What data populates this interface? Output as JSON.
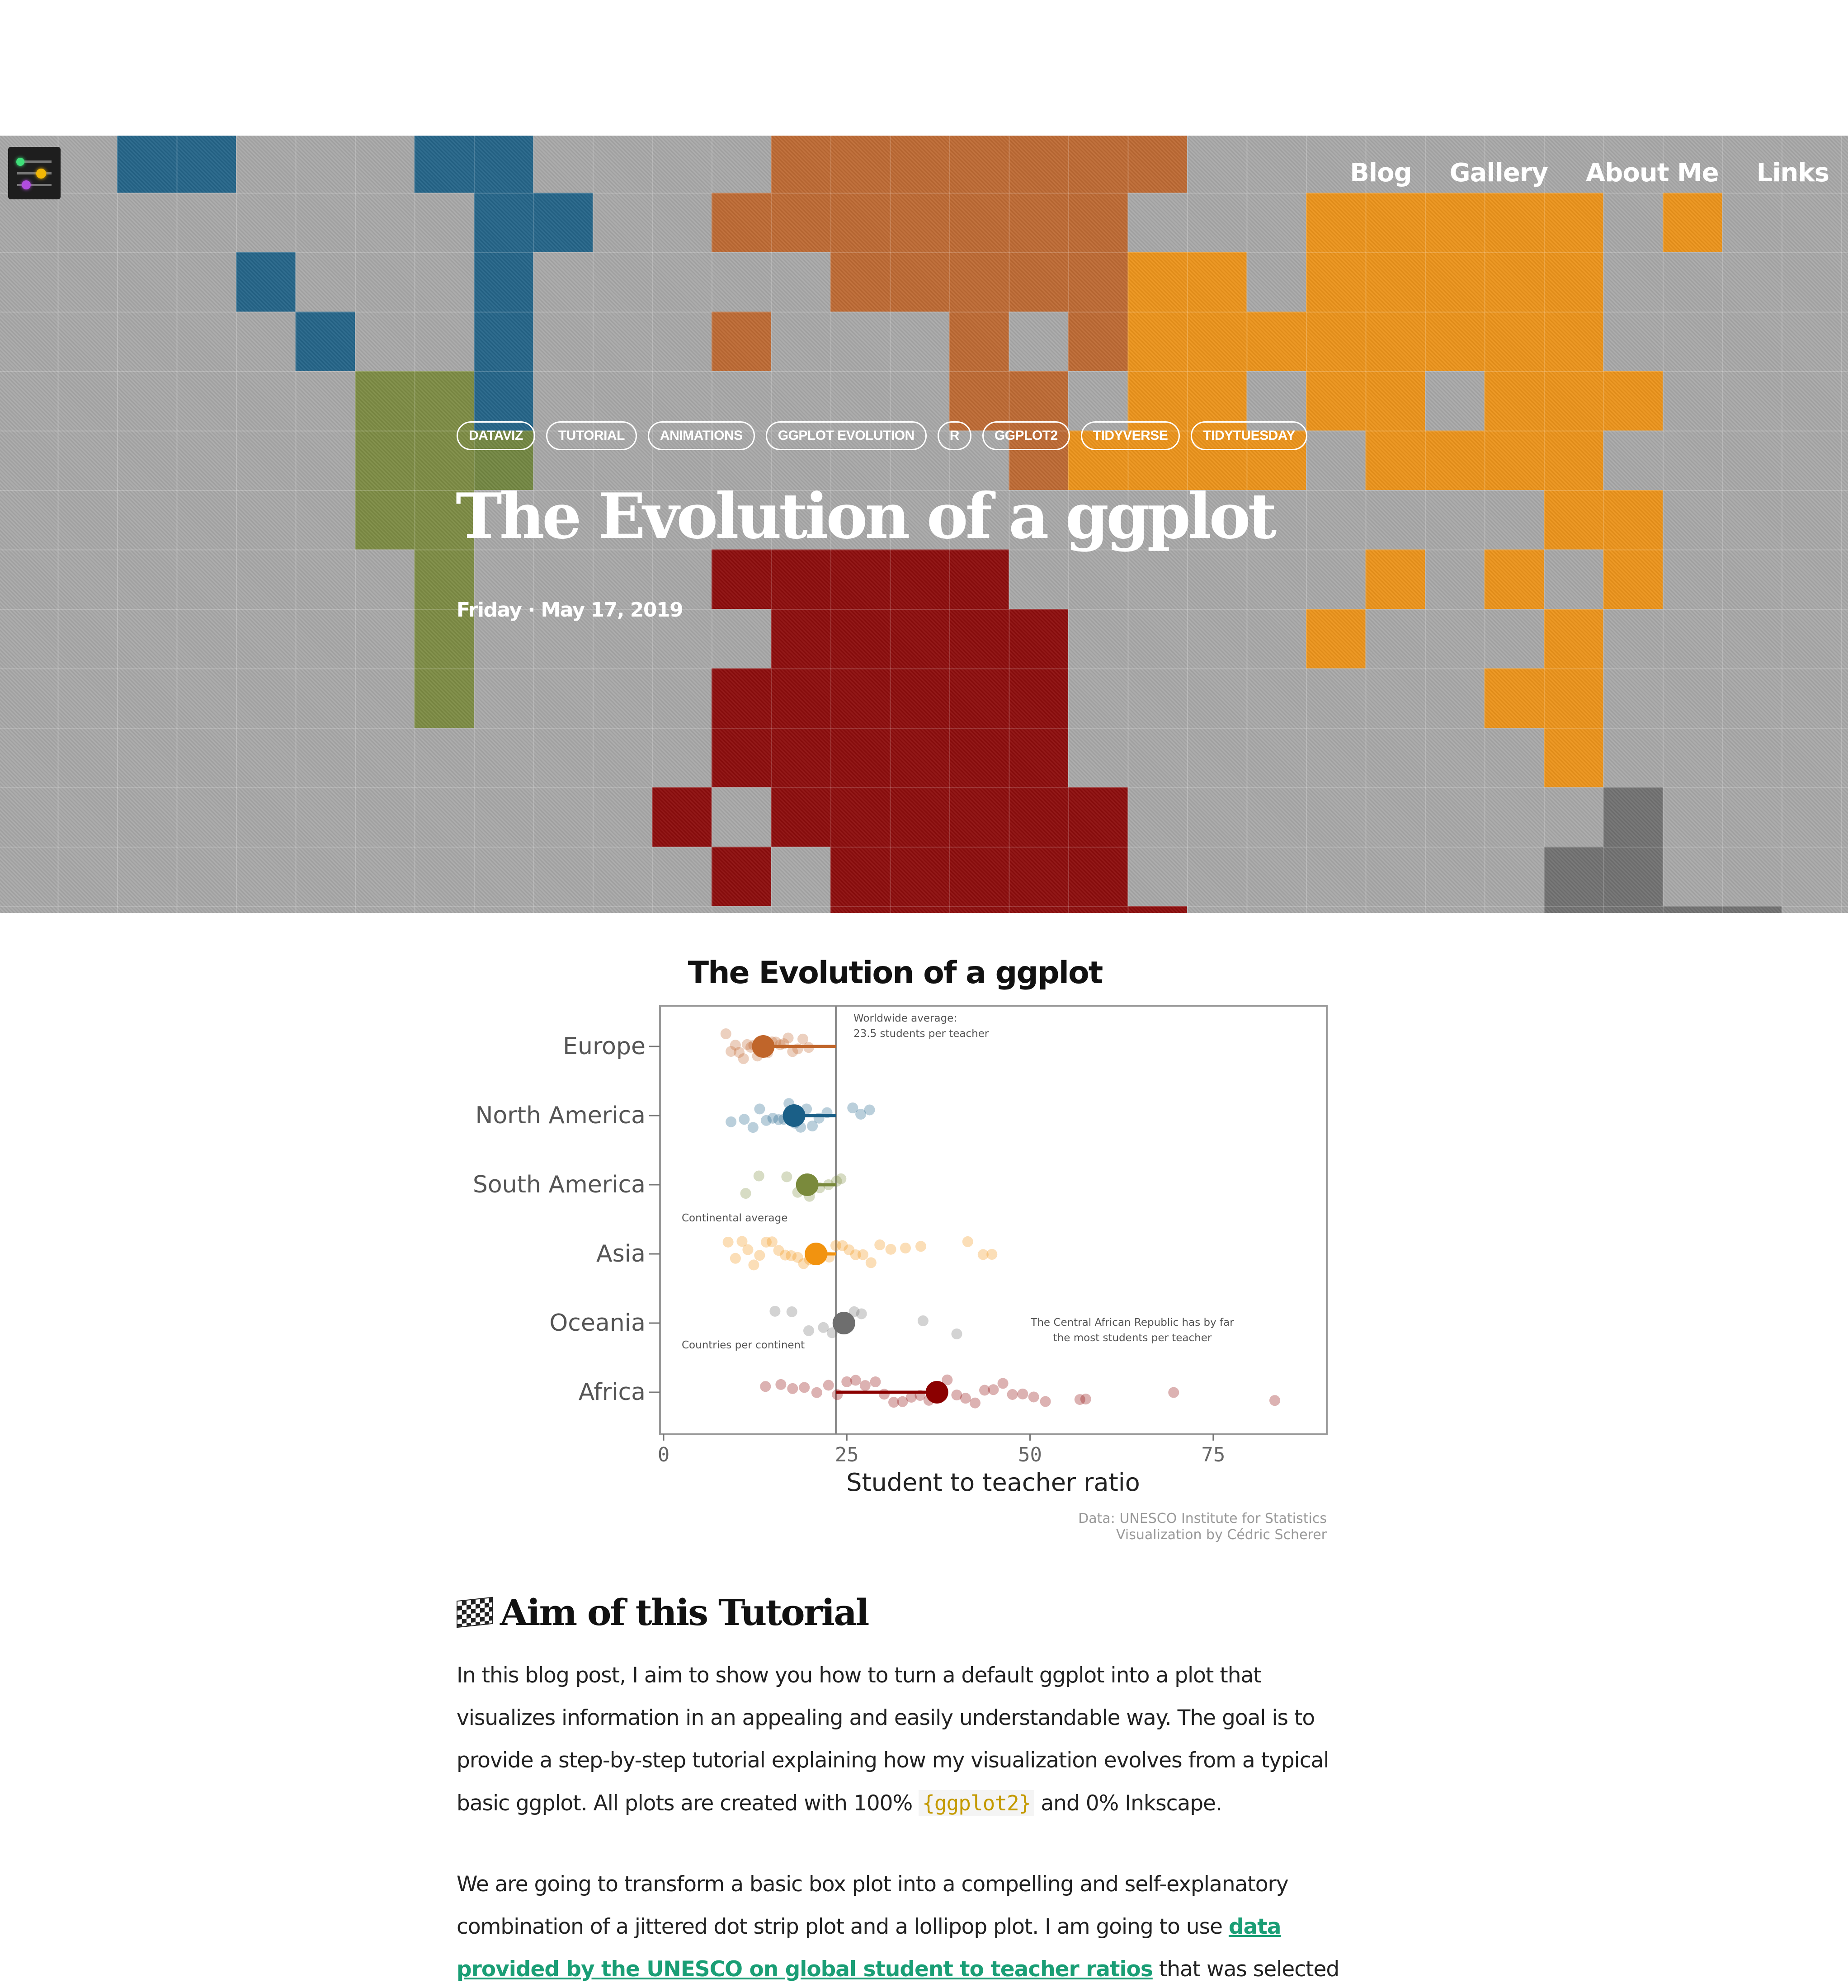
{
  "nav": {
    "logo_alt": "site logo",
    "links": [
      "Blog",
      "Gallery",
      "About Me",
      "Links"
    ]
  },
  "tags": [
    "DATAVIZ",
    "TUTORIAL",
    "ANIMATIONS",
    "GGPLOT EVOLUTION",
    "R",
    "GGPLOT2",
    "TIDYVERSE",
    "TIDYTUESDAY"
  ],
  "post": {
    "title": "The Evolution of a ggplot",
    "date": "Friday · May 17, 2019"
  },
  "colors": {
    "europe": "#c0652a",
    "north_america": "#1a5f87",
    "south_america": "#7a8a3c",
    "asia": "#f2930f",
    "oceania": "#6e6e6e",
    "africa": "#8b0000",
    "link": "#1a9e75",
    "code": "#c49a00"
  },
  "chart_data": {
    "type": "scatter",
    "title": "The Evolution of a ggplot",
    "xlabel": "Student to teacher ratio",
    "ylabel": "",
    "xlim": [
      0,
      90
    ],
    "xticks": [
      0,
      25,
      50,
      75
    ],
    "categories": [
      "Europe",
      "North America",
      "South America",
      "Asia",
      "Oceania",
      "Africa"
    ],
    "worldwide_average": 23.5,
    "continent_averages": [
      13.6,
      17.8,
      19.6,
      20.8,
      24.6,
      37.3
    ],
    "series": [
      {
        "name": "Europe",
        "values": [
          8.5,
          9.2,
          9.8,
          10.3,
          10.9,
          11.4,
          11.9,
          12.3,
          12.8,
          13.2,
          13.7,
          14.2,
          14.8,
          15.3,
          15.9,
          16.4,
          17.0,
          17.6,
          18.3,
          19.0,
          19.8
        ]
      },
      {
        "name": "North America",
        "values": [
          9.2,
          11.0,
          12.2,
          13.1,
          14.0,
          14.9,
          15.7,
          16.4,
          17.1,
          17.9,
          18.7,
          19.5,
          20.3,
          21.2,
          22.3,
          25.8,
          26.9,
          28.1
        ]
      },
      {
        "name": "South America",
        "values": [
          11.2,
          13.0,
          16.8,
          18.3,
          19.9,
          21.3,
          22.5,
          23.6,
          24.2
        ]
      },
      {
        "name": "Asia",
        "values": [
          8.8,
          9.8,
          10.7,
          11.5,
          12.3,
          13.1,
          14.0,
          14.8,
          15.7,
          16.6,
          17.4,
          18.3,
          19.1,
          19.9,
          20.8,
          21.7,
          22.6,
          23.5,
          24.4,
          25.3,
          26.2,
          27.2,
          28.3,
          29.5,
          31.0,
          33.0,
          35.1,
          41.5,
          43.6,
          44.8
        ]
      },
      {
        "name": "Oceania",
        "values": [
          15.2,
          17.5,
          19.8,
          21.8,
          23.0,
          26.0,
          27.0,
          35.4,
          40.0
        ]
      },
      {
        "name": "Africa",
        "values": [
          13.9,
          16.0,
          17.6,
          19.2,
          20.9,
          22.5,
          23.7,
          25.0,
          26.2,
          27.5,
          28.9,
          30.1,
          31.4,
          32.6,
          33.8,
          35.0,
          36.2,
          37.5,
          38.7,
          40.0,
          41.2,
          42.5,
          43.8,
          45.0,
          46.3,
          47.6,
          49.0,
          50.5,
          52.1,
          56.8,
          57.6,
          69.6,
          83.4
        ]
      }
    ],
    "annotations": [
      "Worldwide average:\n23.5 students per teacher",
      "Continental average",
      "Countries per continent",
      "The Central African Republic has by far\nthe most students per teacher"
    ],
    "caption": [
      "Data: UNESCO Institute for Statistics",
      "Visualization by Cédric Scherer"
    ],
    "grid": false,
    "legend": "none"
  },
  "article": {
    "heading": "Aim of this Tutorial",
    "p1_before": "In this blog post, I aim to show you how to turn a default ggplot into a plot that visualizes information in an appealing and easily understandable way. The goal is to provide a step-by-step tutorial explaining how my visualization evolves from a typical basic ggplot. All plots are created with 100% ",
    "p1_code": "{ggplot2}",
    "p1_after": " and 0% Inkscape.",
    "p2_before": "We are going to transform a basic box plot into a compelling and self-explanatory combination of a jittered dot strip plot and a lollipop plot. I am going to use ",
    "p2_link": "data provided by the UNESCO on global student to teacher ratios",
    "p2_after": " that was selected as"
  }
}
